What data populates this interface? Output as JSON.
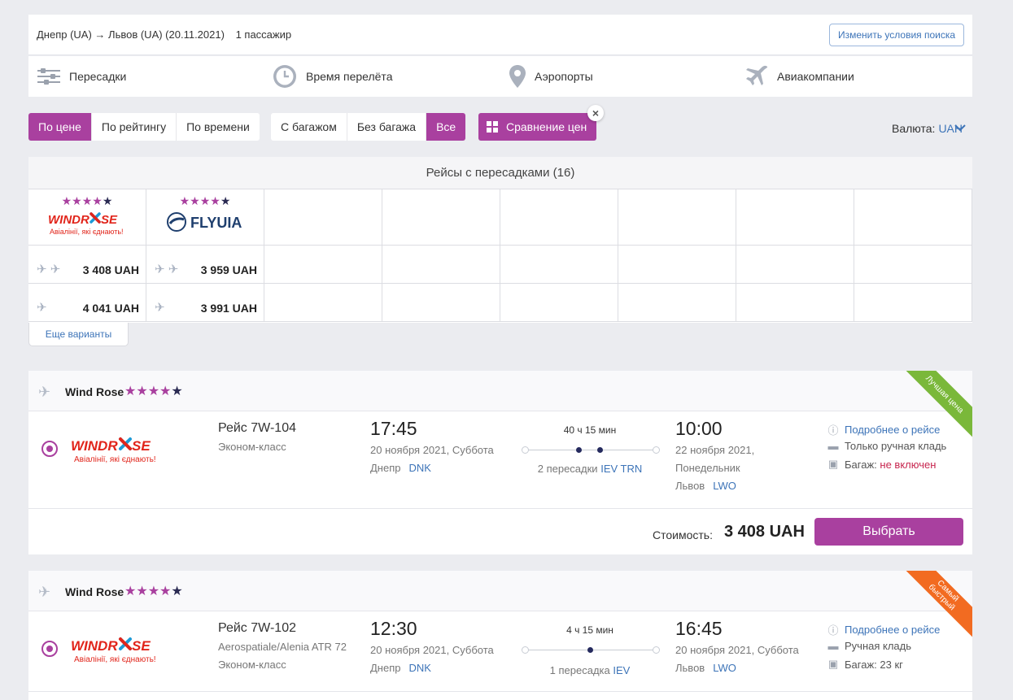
{
  "summary": {
    "route": "Днепр (UA) → Львов (UA) (20.11.2021)",
    "passengers": "1 пассажир",
    "change_label": "Изменить условия поиска"
  },
  "filters": [
    {
      "label": "Пересадки",
      "icon": "sliders-icon"
    },
    {
      "label": "Время перелёта",
      "icon": "clock-icon"
    },
    {
      "label": "Аэропорты",
      "icon": "location-pin-icon"
    },
    {
      "label": "Авиакомпании",
      "icon": "plane-icon"
    }
  ],
  "sort": [
    "По цене",
    "По рейтингу",
    "По времени"
  ],
  "baggage": [
    "С багажом",
    "Без багажа",
    "Все"
  ],
  "compare_label": "Сравнение цен",
  "currency": {
    "label": "Валюта:",
    "value": "UAH"
  },
  "matrix": {
    "title": "Рейсы с пересадками (16)",
    "airlines": [
      {
        "name": "WINDROSE",
        "tagline": "Авіалінії, які єднають!",
        "rating": 4,
        "prices": [
          "3 408 UAH",
          "4 041 UAH"
        ]
      },
      {
        "name": "FLYUIA",
        "tagline": "",
        "rating": 4,
        "prices": [
          "3 959 UAH",
          "3 991 UAH"
        ]
      }
    ],
    "more_label": "Еще варианты"
  },
  "cards": [
    {
      "airline": "Wind Rose",
      "rating": 4,
      "ribbon": "Лучшая цена",
      "ribbon_color": "#7ab83a",
      "logo_name": "WINDROSE",
      "logo_tagline": "Авіалінії, які єднають!",
      "flight": "Рейс 7W-104",
      "aircraft": "",
      "cabin": "Эконом-класс",
      "dep_time": "17:45",
      "dep_date": "20 ноября 2021, Суббота",
      "dep_city": "Днепр",
      "dep_code": "DNK",
      "duration": "40 ч 15 мин",
      "stops_text": "2 пересадки",
      "stop_codes": "IEV TRN",
      "arr_time": "10:00",
      "arr_date": "22 ноября 2021,",
      "arr_date2": "Понедельник",
      "arr_city": "Львов",
      "arr_code": "LWO",
      "details_link": "Подробнее о рейсе",
      "hand_luggage": "Только ручная кладь",
      "baggage_label": "Багаж:",
      "baggage_value": "не включен",
      "price_label": "Стоимость:",
      "price": "3 408 UAH",
      "select_label": "Выбрать"
    },
    {
      "airline": "Wind Rose",
      "rating": 4,
      "ribbon": "Самый быстрый",
      "ribbon_color": "#f26b21",
      "logo_name": "WINDROSE",
      "logo_tagline": "Авіалінії, які єднають!",
      "flight": "Рейс 7W-102",
      "aircraft": "Aerospatiale/Alenia ATR 72",
      "cabin": "Эконом-класс",
      "dep_time": "12:30",
      "dep_date": "20 ноября 2021, Суббота",
      "dep_city": "Днепр",
      "dep_code": "DNK",
      "duration": "4 ч 15 мин",
      "stops_text": "1 пересадка",
      "stop_codes": "IEV",
      "arr_time": "16:45",
      "arr_date": "20 ноября 2021, Суббота",
      "arr_city": "Львов",
      "arr_code": "LWO",
      "details_link": "Подробнее о рейсе",
      "hand_luggage": "Ручная кладь",
      "baggage_label": "Багаж:",
      "baggage_value": "23 кг"
    }
  ],
  "colors": {
    "accent": "#a9409f",
    "link": "#3d74b8",
    "star_dark": "#2a2a52"
  }
}
